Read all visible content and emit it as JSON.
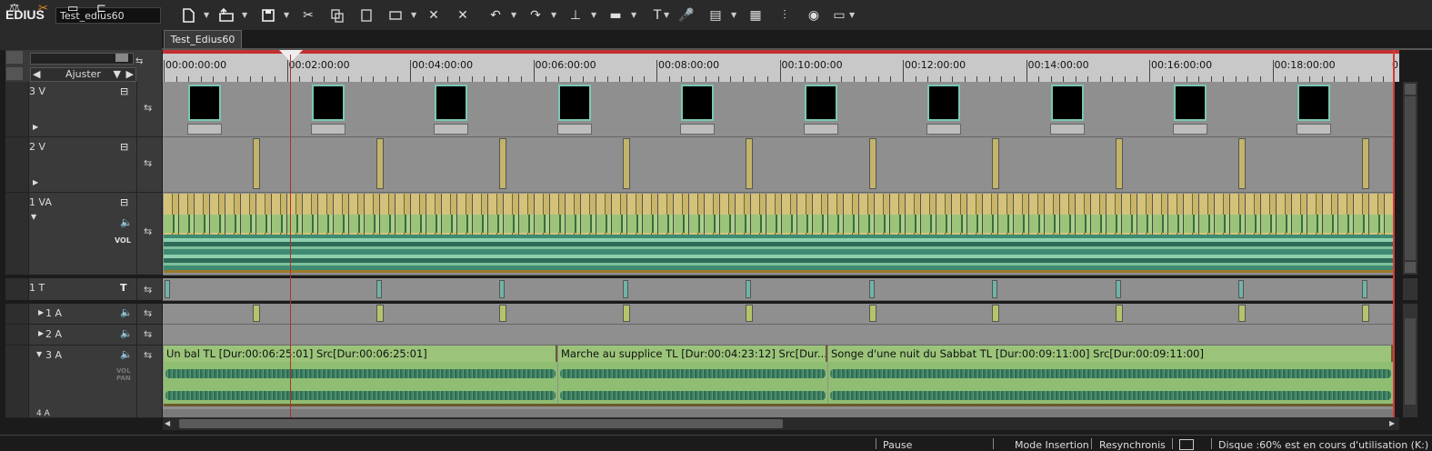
{
  "app": {
    "name": "EDIUS",
    "project_name": "Test_edius60"
  },
  "toolbar": {
    "icons": [
      "new-icon",
      "open-icon",
      "save-icon",
      "cut-icon",
      "copy-icon",
      "paste-icon",
      "replace-icon",
      "delete-icon",
      "ripple-delete-icon",
      "undo-icon",
      "redo-icon",
      "add-marker-icon",
      "mixer-icon",
      "title-icon",
      "voice-icon",
      "render-icon",
      "layout-icon",
      "audio-mixer-icon",
      "color-icon",
      "view-icon"
    ]
  },
  "sequence_tab": {
    "label": "Test_Edius60"
  },
  "zoom": {
    "label": "Ajuster"
  },
  "ruler": {
    "ticks": [
      "00:00:00:00",
      "00:02:00:00",
      "00:04:00:00",
      "00:06:00:00",
      "00:08:00:00",
      "00:10:00:00",
      "00:12:00:00",
      "00:14:00:00",
      "00:16:00:00",
      "00:18:00:00"
    ],
    "end_label": "0"
  },
  "tracks": {
    "v3": {
      "name": "3 V"
    },
    "v2": {
      "name": "2 V"
    },
    "va1": {
      "name": "1 VA",
      "vol_label": "VOL"
    },
    "t1": {
      "name": "1 T",
      "t_label": "T"
    },
    "a1": {
      "name": "1 A"
    },
    "a2": {
      "name": "2 A"
    },
    "a3": {
      "name": "3 A",
      "vol_label": "VOL",
      "pan_label": "PAN"
    },
    "a4": {
      "name": "4 A"
    }
  },
  "clips": {
    "a3": [
      {
        "title": "Un bal  TL [Dur:00:06:25:01]  Src[Dur:00:06:25:01]"
      },
      {
        "title": "Marche au supplice  TL [Dur:00:04:23:12]  Src[Dur..."
      },
      {
        "title": "Songe d'une nuit du Sabbat  TL [Dur:00:09:11:00]  Src[Dur:00:09:11:00]"
      }
    ]
  },
  "status": {
    "state": "Pause",
    "mode": "Mode Insertion",
    "sync": "Resynchronis",
    "disk": "Disque :60% est en cours d'utilisation (K:)"
  },
  "colors": {
    "accent": "#79c7b5",
    "clip_green": "#9bc47a",
    "transition": "#c2b46a",
    "playhead": "#b03030"
  }
}
